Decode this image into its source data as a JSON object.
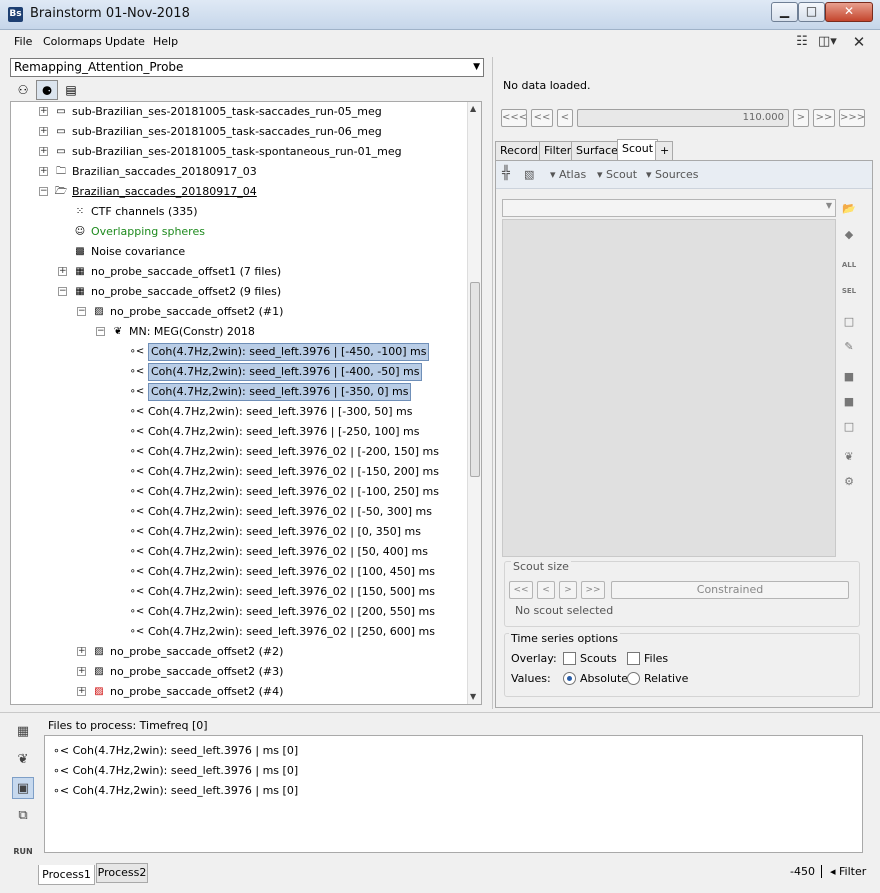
{
  "window": {
    "title": "Brainstorm 01-Nov-2018",
    "logo": "Bs",
    "min_label": "▁",
    "max_label": "□",
    "close_label": "✕"
  },
  "menu": {
    "file": "File",
    "colormaps": "Colormaps",
    "update": "Update",
    "help": "Help"
  },
  "protocol": {
    "selected": "Remapping_Attention_Probe"
  },
  "tree": {
    "rows": [
      {
        "indent": 1,
        "expander": "+",
        "icon": "raw-file-icon",
        "label": "sub-Brazilian_ses-20181005_task-saccades_run-05_meg",
        "color": "#000",
        "selected": false
      },
      {
        "indent": 1,
        "expander": "+",
        "icon": "raw-file-icon",
        "label": "sub-Brazilian_ses-20181005_task-saccades_run-06_meg",
        "color": "#000",
        "selected": false
      },
      {
        "indent": 1,
        "expander": "+",
        "icon": "raw-file-icon",
        "label": "sub-Brazilian_ses-20181005_task-spontaneous_run-01_meg",
        "color": "#000",
        "selected": false
      },
      {
        "indent": 1,
        "expander": "+",
        "icon": "folder-icon",
        "label": "Brazilian_saccades_20180917_03",
        "color": "#000",
        "selected": false
      },
      {
        "indent": 1,
        "expander": "-",
        "icon": "folder-open-icon",
        "label": "Brazilian_saccades_20180917_04",
        "color": "#000",
        "selected": false,
        "underline": true
      },
      {
        "indent": 2,
        "expander": "",
        "icon": "channel-icon",
        "label": "CTF channels (335)",
        "color": "#000",
        "selected": false
      },
      {
        "indent": 2,
        "expander": "",
        "icon": "head-model-icon",
        "label": "Overlapping spheres",
        "color": "#1e8a1e",
        "selected": false
      },
      {
        "indent": 2,
        "expander": "",
        "icon": "noise-cov-icon",
        "label": "Noise covariance",
        "color": "#000",
        "selected": false
      },
      {
        "indent": 2,
        "expander": "+",
        "icon": "condition-icon",
        "label": "no_probe_saccade_offset1 (7 files)",
        "color": "#000",
        "selected": false
      },
      {
        "indent": 2,
        "expander": "-",
        "icon": "condition-icon",
        "label": "no_probe_saccade_offset2 (9 files)",
        "color": "#000",
        "selected": false
      },
      {
        "indent": 3,
        "expander": "-",
        "icon": "data-icon",
        "label": "no_probe_saccade_offset2 (#1)",
        "color": "#000",
        "selected": false
      },
      {
        "indent": 4,
        "expander": "-",
        "icon": "link-brain-icon",
        "label": "MN: MEG(Constr) 2018",
        "color": "#000",
        "selected": false
      },
      {
        "indent": 5,
        "expander": "",
        "icon": "connectivity-icon",
        "label": "Coh(4.7Hz,2win): seed_left.3976 | [-450, -100] ms",
        "color": "#000",
        "selected": true
      },
      {
        "indent": 5,
        "expander": "",
        "icon": "connectivity-icon",
        "label": "Coh(4.7Hz,2win): seed_left.3976 | [-400, -50] ms",
        "color": "#000",
        "selected": true
      },
      {
        "indent": 5,
        "expander": "",
        "icon": "connectivity-icon",
        "label": "Coh(4.7Hz,2win): seed_left.3976 | [-350, 0] ms",
        "color": "#000",
        "selected": true
      },
      {
        "indent": 5,
        "expander": "",
        "icon": "connectivity-icon",
        "label": "Coh(4.7Hz,2win): seed_left.3976 | [-300, 50] ms",
        "color": "#000",
        "selected": false
      },
      {
        "indent": 5,
        "expander": "",
        "icon": "connectivity-icon",
        "label": "Coh(4.7Hz,2win): seed_left.3976 | [-250, 100] ms",
        "color": "#000",
        "selected": false
      },
      {
        "indent": 5,
        "expander": "",
        "icon": "connectivity-icon",
        "label": "Coh(4.7Hz,2win): seed_left.3976_02 | [-200, 150] ms",
        "color": "#000",
        "selected": false
      },
      {
        "indent": 5,
        "expander": "",
        "icon": "connectivity-icon",
        "label": "Coh(4.7Hz,2win): seed_left.3976_02 | [-150, 200] ms",
        "color": "#000",
        "selected": false
      },
      {
        "indent": 5,
        "expander": "",
        "icon": "connectivity-icon",
        "label": "Coh(4.7Hz,2win): seed_left.3976_02 | [-100, 250] ms",
        "color": "#000",
        "selected": false
      },
      {
        "indent": 5,
        "expander": "",
        "icon": "connectivity-icon",
        "label": "Coh(4.7Hz,2win): seed_left.3976_02 | [-50, 300] ms",
        "color": "#000",
        "selected": false
      },
      {
        "indent": 5,
        "expander": "",
        "icon": "connectivity-icon",
        "label": "Coh(4.7Hz,2win): seed_left.3976_02 | [0, 350] ms",
        "color": "#000",
        "selected": false
      },
      {
        "indent": 5,
        "expander": "",
        "icon": "connectivity-icon",
        "label": "Coh(4.7Hz,2win): seed_left.3976_02 | [50, 400] ms",
        "color": "#000",
        "selected": false
      },
      {
        "indent": 5,
        "expander": "",
        "icon": "connectivity-icon",
        "label": "Coh(4.7Hz,2win): seed_left.3976_02 | [100, 450] ms",
        "color": "#000",
        "selected": false
      },
      {
        "indent": 5,
        "expander": "",
        "icon": "connectivity-icon",
        "label": "Coh(4.7Hz,2win): seed_left.3976_02 | [150, 500] ms",
        "color": "#000",
        "selected": false
      },
      {
        "indent": 5,
        "expander": "",
        "icon": "connectivity-icon",
        "label": "Coh(4.7Hz,2win): seed_left.3976_02 | [200, 550] ms",
        "color": "#000",
        "selected": false
      },
      {
        "indent": 5,
        "expander": "",
        "icon": "connectivity-icon",
        "label": "Coh(4.7Hz,2win): seed_left.3976_02 | [250, 600] ms",
        "color": "#000",
        "selected": false
      },
      {
        "indent": 3,
        "expander": "+",
        "icon": "data-icon",
        "label": "no_probe_saccade_offset2 (#2)",
        "color": "#000",
        "selected": false
      },
      {
        "indent": 3,
        "expander": "+",
        "icon": "data-icon",
        "label": "no_probe_saccade_offset2 (#3)",
        "color": "#000",
        "selected": false
      },
      {
        "indent": 3,
        "expander": "+",
        "icon": "data-bad-icon",
        "label": "no_probe_saccade_offset2 (#4)",
        "color": "#000",
        "selected": false
      }
    ]
  },
  "right": {
    "no_data": "No data loaded.",
    "nav": {
      "first": "<<<",
      "pprev": "<<",
      "prev": "<",
      "time": "110.000",
      "next": ">",
      "nnext": ">>",
      "last": ">>>"
    },
    "tabs": {
      "record": "Record",
      "filter": "Filter",
      "surface": "Surface",
      "scout": "Scout",
      "add": "+"
    },
    "toolbar": {
      "atlas": "Atlas",
      "scout": "Scout",
      "sources": "Sources"
    },
    "side_buttons": {
      "all": "ALL",
      "sel": "SEL"
    },
    "scout_size": {
      "label": "Scout size",
      "pprev": "<<",
      "prev": "<",
      "next": ">",
      "nnext": ">>",
      "constrained": "Constrained",
      "no_scout": "No scout selected"
    },
    "time_series": {
      "label": "Time series options",
      "overlay": "Overlay:",
      "scouts": "Scouts",
      "files": "Files",
      "values": "Values:",
      "absolute": "Absolute",
      "relative": "Relative",
      "scouts_checked": false,
      "files_checked": false,
      "absolute_selected": true
    }
  },
  "bottom": {
    "files_label": "Files to process: Timefreq [0]",
    "files": [
      "Coh(4.7Hz,2win): seed_left.3976 |  ms [0]",
      "Coh(4.7Hz,2win): seed_left.3976 |  ms [0]",
      "Coh(4.7Hz,2win): seed_left.3976 |  ms [0]"
    ],
    "run_label": "RUN",
    "tab_process1": "Process1",
    "tab_process2": "Process2",
    "search_value": "-450",
    "filter_label": "Filter"
  }
}
